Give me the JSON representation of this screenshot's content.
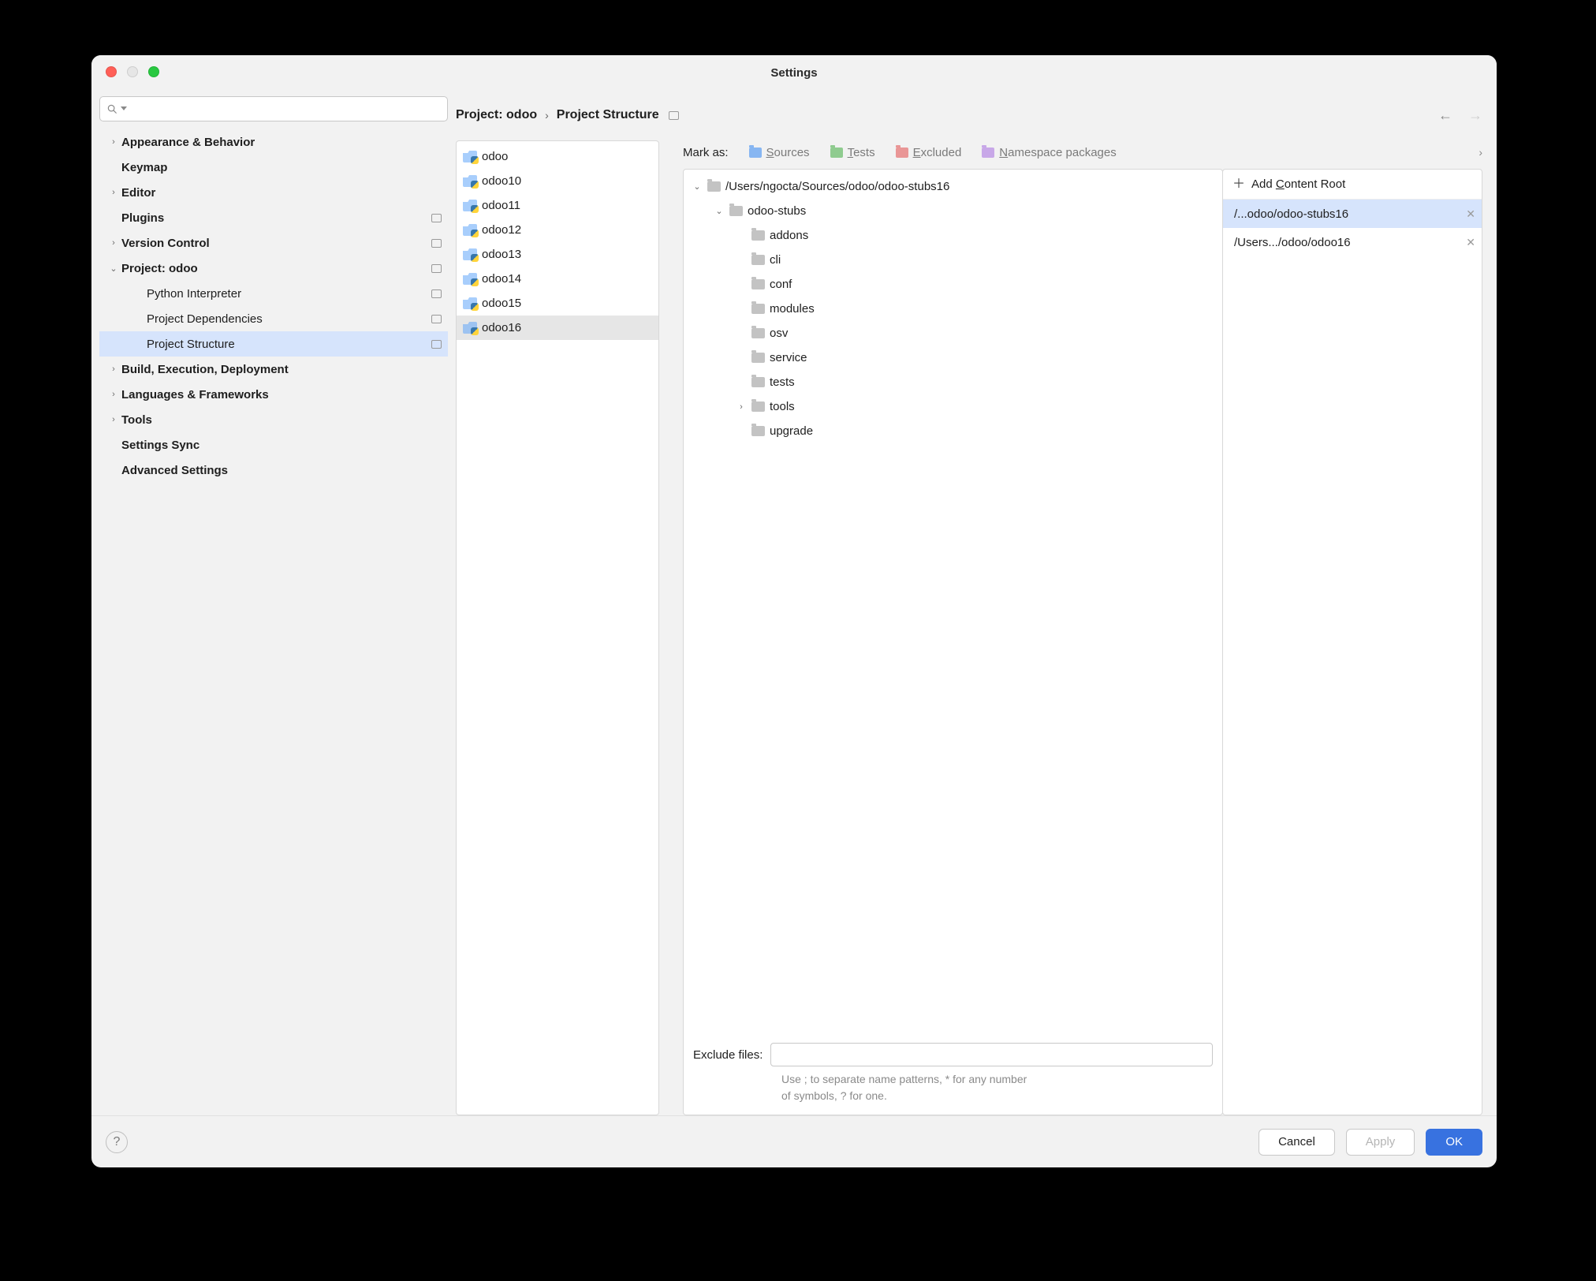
{
  "window": {
    "title": "Settings"
  },
  "sidebar": {
    "search_placeholder": "",
    "items": [
      {
        "label": "Appearance & Behavior",
        "expandable": true,
        "level": 1
      },
      {
        "label": "Keymap",
        "expandable": false,
        "level": 1
      },
      {
        "label": "Editor",
        "expandable": true,
        "level": 1
      },
      {
        "label": "Plugins",
        "expandable": false,
        "level": 1,
        "badge": true
      },
      {
        "label": "Version Control",
        "expandable": true,
        "level": 1,
        "badge": true
      },
      {
        "label": "Project: odoo",
        "expandable": true,
        "expanded": true,
        "level": 1,
        "badge": true
      },
      {
        "label": "Python Interpreter",
        "level": 2,
        "badge": true
      },
      {
        "label": "Project Dependencies",
        "level": 2,
        "badge": true
      },
      {
        "label": "Project Structure",
        "level": 2,
        "badge": true,
        "selected": true
      },
      {
        "label": "Build, Execution, Deployment",
        "expandable": true,
        "level": 1
      },
      {
        "label": "Languages & Frameworks",
        "expandable": true,
        "level": 1
      },
      {
        "label": "Tools",
        "expandable": true,
        "level": 1
      },
      {
        "label": "Settings Sync",
        "expandable": false,
        "level": 1
      },
      {
        "label": "Advanced Settings",
        "expandable": false,
        "level": 1
      }
    ]
  },
  "breadcrumb": {
    "project": "Project: odoo",
    "page": "Project Structure"
  },
  "modules": [
    {
      "name": "odoo"
    },
    {
      "name": "odoo10"
    },
    {
      "name": "odoo11"
    },
    {
      "name": "odoo12"
    },
    {
      "name": "odoo13"
    },
    {
      "name": "odoo14"
    },
    {
      "name": "odoo15"
    },
    {
      "name": "odoo16",
      "selected": true
    }
  ],
  "mark_as": {
    "label": "Mark as:",
    "sources": "Sources",
    "tests": "Tests",
    "excluded": "Excluded",
    "namespace": "Namespace packages"
  },
  "dir_tree": {
    "root_path": "/Users/ngocta/Sources/odoo/odoo-stubs16",
    "stubs_label": "odoo-stubs",
    "children": [
      "addons",
      "cli",
      "conf",
      "modules",
      "osv",
      "service",
      "tests",
      "tools",
      "upgrade"
    ],
    "tools_expandable": true
  },
  "exclude": {
    "label": "Exclude files:",
    "value": "",
    "hint": "Use ; to separate name patterns, * for any number of symbols, ? for one."
  },
  "content_roots": {
    "add_label": "Add Content Root",
    "items": [
      {
        "path": "/...odoo/odoo-stubs16",
        "selected": true
      },
      {
        "path": "/Users.../odoo/odoo16"
      }
    ]
  },
  "footer": {
    "cancel": "Cancel",
    "apply": "Apply",
    "ok": "OK"
  }
}
